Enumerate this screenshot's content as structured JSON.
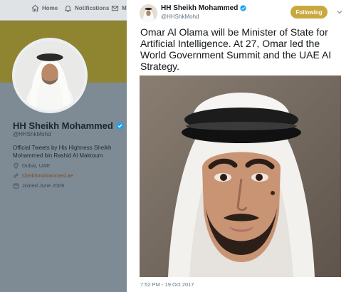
{
  "top_nav": {
    "home_label": "Home",
    "notifications_label": "Notifications",
    "messages_label": "M"
  },
  "profile": {
    "name": "HH Sheikh Mohammed",
    "handle": "@HHShkMohd",
    "bio": "Official Tweets by His Highness Sheikh Mohammed bin Rashid Al Maktoum",
    "location": "Dubai, UAE",
    "website": "sheikhmohammed.ae",
    "joined": "Joined June 2009"
  },
  "tweet": {
    "author_name": "HH Sheikh Mohammed",
    "author_handle": "@HHShkMohd",
    "follow_label": "Following",
    "text": "Omar Al Olama will be Minister of State for Artificial Intelligence. At 27, Omar led the World Government Summit and the UAE AI Strategy.",
    "timestamp": "7:52 PM - 19 Oct 2017"
  },
  "colors": {
    "following_button": "#c9a93f",
    "banner": "#8f8530",
    "verified": "#1da1f2",
    "overlay": "#7e8a94"
  },
  "icons": {
    "home": "home-icon",
    "notifications": "bell-icon",
    "messages": "mail-icon",
    "verified": "verified-badge-icon",
    "location": "location-pin-icon",
    "website": "link-icon",
    "joined": "calendar-icon",
    "menu": "chevron-down-icon"
  }
}
